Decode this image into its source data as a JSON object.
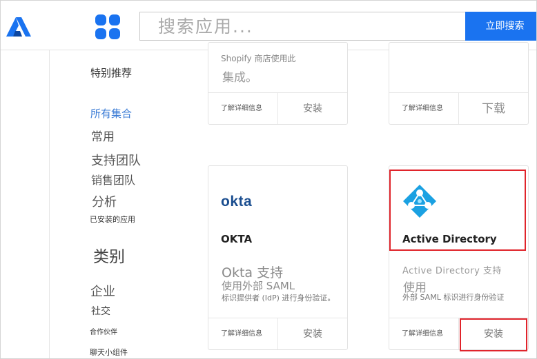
{
  "search": {
    "placeholder": "搜索应用...",
    "button_label": "立即搜索"
  },
  "sidebar": {
    "featured": "特别推荐",
    "all_collections": "所有集合",
    "common": "常用",
    "support_team": "支持团队",
    "sales_team": "销售团队",
    "analysis": "分析",
    "installed_apps": "已安装的应用",
    "category_heading": "类别",
    "enterprise": "企业",
    "social": "社交",
    "partners": "合作伙伴",
    "chat_widgets": "聊天小组件"
  },
  "cards": {
    "shopify": {
      "desc_line1": "Shopify 商店使用此",
      "desc_line2": "集成。",
      "learn_more": "了解详细信息",
      "action": "安装"
    },
    "top_right": {
      "learn_more": "了解详细信息",
      "action": "下载"
    },
    "okta": {
      "logo_text": "okta",
      "title": "OKTA",
      "desc_line1": "Okta 支持",
      "desc_line2": "使用外部 SAML",
      "desc_line3": "标识提供者 (IdP) 进行身份验证。",
      "learn_more": "了解详细信息",
      "action": "安装"
    },
    "active_directory": {
      "title": "Active Directory",
      "desc_line1": "Active  Directory 支持",
      "desc_line2": "使用",
      "desc_line3": "外部 SAML 标识进行身份验证",
      "learn_more": "了解详细信息",
      "action": "安装"
    }
  },
  "colors": {
    "accent": "#1a73f0",
    "highlight": "#e0242b",
    "sidebar_active": "#3a7bd5",
    "okta_brand": "#1a4d8f",
    "ad_brand": "#1ba1e2"
  },
  "icons": [
    "brand-logo-icon",
    "apps-grid-icon",
    "active-directory-icon"
  ]
}
